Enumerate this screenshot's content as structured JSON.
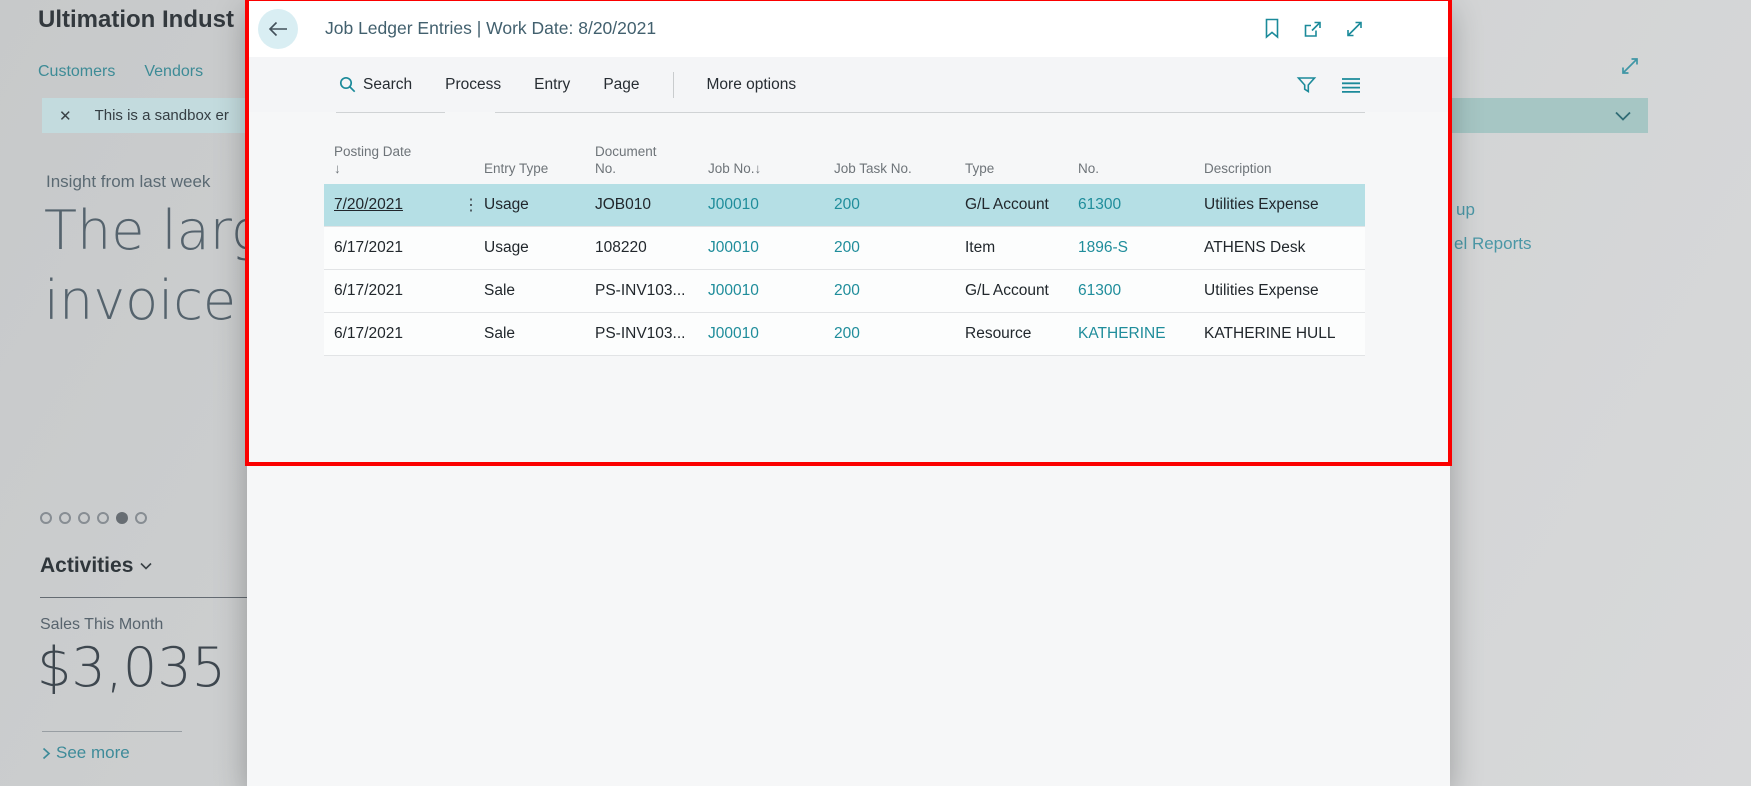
{
  "colors": {
    "accent_teal": "#1b8a9a",
    "link_teal": "#1f8d9b",
    "selected_row": "#b5dfe5",
    "annotation_red": "#fb0000",
    "banner_teal_left": "#c3dbde",
    "banner_teal_right": "#a6c6c4"
  },
  "backdrop": {
    "company_name": "Ultimation Indust",
    "nav_tabs": [
      "Customers",
      "Vendors"
    ],
    "banner": {
      "close": "✕",
      "text": "This is a sandbox er"
    },
    "insight_eyebrow": "Insight from last week",
    "insight_line1": "The larg",
    "insight_line2": "invoice",
    "carousel_dots": {
      "count": 6,
      "active_index": 4
    },
    "activities_title": "Activities",
    "sales_label": "Sales This Month",
    "sales_value": "$3,035",
    "see_more": "See more",
    "right_links": [
      "up",
      "el Reports"
    ]
  },
  "modal": {
    "title": "Job Ledger Entries | Work Date: 8/20/2021",
    "toolbar": {
      "search": "Search",
      "items": [
        "Process",
        "Entry",
        "Page"
      ],
      "more": "More options"
    }
  },
  "table": {
    "columns": [
      {
        "key": "posting_date",
        "label_lines": [
          "Posting Date",
          "↓"
        ],
        "link": false
      },
      {
        "key": "menu",
        "label_lines": [],
        "link": false
      },
      {
        "key": "entry_type",
        "label_lines": [
          "Entry Type"
        ],
        "link": false
      },
      {
        "key": "document_no",
        "label_lines": [
          "Document",
          "No."
        ],
        "link": false
      },
      {
        "key": "job_no",
        "label_lines": [
          "Job No.↓"
        ],
        "link": true
      },
      {
        "key": "job_task_no",
        "label_lines": [
          "Job Task No."
        ],
        "link": true
      },
      {
        "key": "type",
        "label_lines": [
          "Type"
        ],
        "link": false
      },
      {
        "key": "no",
        "label_lines": [
          "No."
        ],
        "link": true
      },
      {
        "key": "description",
        "label_lines": [
          "Description"
        ],
        "link": false
      }
    ],
    "rows": [
      {
        "posting_date": "7/20/2021",
        "menu": "⋮",
        "entry_type": "Usage",
        "document_no": "JOB010",
        "job_no": "J00010",
        "job_task_no": "200",
        "type": "G/L Account",
        "no": "61300",
        "description": "Utilities Expense",
        "selected": true
      },
      {
        "posting_date": "6/17/2021",
        "menu": "",
        "entry_type": "Usage",
        "document_no": "108220",
        "job_no": "J00010",
        "job_task_no": "200",
        "type": "Item",
        "no": "1896-S",
        "description": "ATHENS Desk",
        "selected": false
      },
      {
        "posting_date": "6/17/2021",
        "menu": "",
        "entry_type": "Sale",
        "document_no": "PS-INV103...",
        "job_no": "J00010",
        "job_task_no": "200",
        "type": "G/L Account",
        "no": "61300",
        "description": "Utilities Expense",
        "selected": false
      },
      {
        "posting_date": "6/17/2021",
        "menu": "",
        "entry_type": "Sale",
        "document_no": "PS-INV103...",
        "job_no": "J00010",
        "job_task_no": "200",
        "type": "Resource",
        "no": "KATHERINE",
        "description": "KATHERINE HULL",
        "selected": false
      }
    ]
  }
}
